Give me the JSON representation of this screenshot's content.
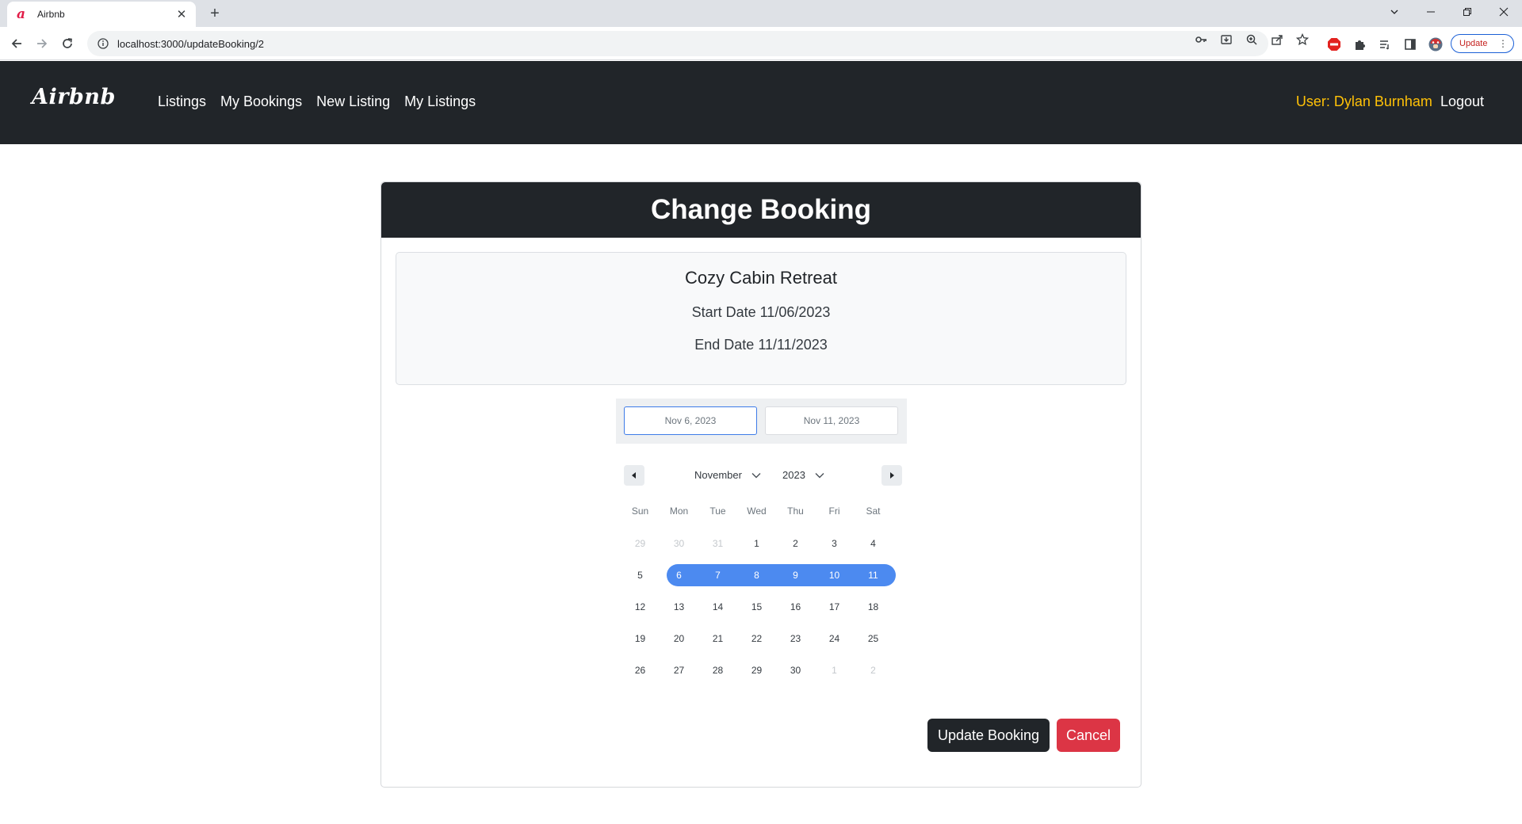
{
  "browser": {
    "tab_title": "Airbnb",
    "tab_close": "✕",
    "new_tab": "+",
    "url": "localhost:3000/updateBooking/2",
    "update_label": "Update",
    "update_menu": "⋮",
    "favicon_glyph": "a"
  },
  "navbar": {
    "brand": "Airbnb",
    "links": [
      {
        "label": "Listings"
      },
      {
        "label": "My Bookings"
      },
      {
        "label": "New Listing"
      },
      {
        "label": "My Listings"
      }
    ],
    "user_label": "User: Dylan Burnham",
    "logout_label": "Logout",
    "user_color": "#ffc107"
  },
  "page": {
    "title": "Change Booking",
    "listing_name": "Cozy Cabin Retreat",
    "start_date_text": "Start Date 11/06/2023",
    "end_date_text": "End Date 11/11/2023"
  },
  "picker": {
    "start_value": "Nov 6, 2023",
    "end_value": "Nov 11, 2023",
    "month": "November",
    "year": "2023",
    "weekdays": [
      "Sun",
      "Mon",
      "Tue",
      "Wed",
      "Thu",
      "Fri",
      "Sat"
    ],
    "selection_color": "#4c8af0",
    "weeks": [
      [
        "29",
        "30",
        "31",
        "1",
        "2",
        "3",
        "4"
      ],
      [
        "5",
        "6",
        "7",
        "8",
        "9",
        "10",
        "11"
      ],
      [
        "12",
        "13",
        "14",
        "15",
        "16",
        "17",
        "18"
      ],
      [
        "19",
        "20",
        "21",
        "22",
        "23",
        "24",
        "25"
      ],
      [
        "26",
        "27",
        "28",
        "29",
        "30",
        "1",
        "2"
      ]
    ]
  },
  "actions": {
    "update_label": "Update Booking",
    "cancel_label": "Cancel",
    "cancel_color": "#dc3545"
  }
}
